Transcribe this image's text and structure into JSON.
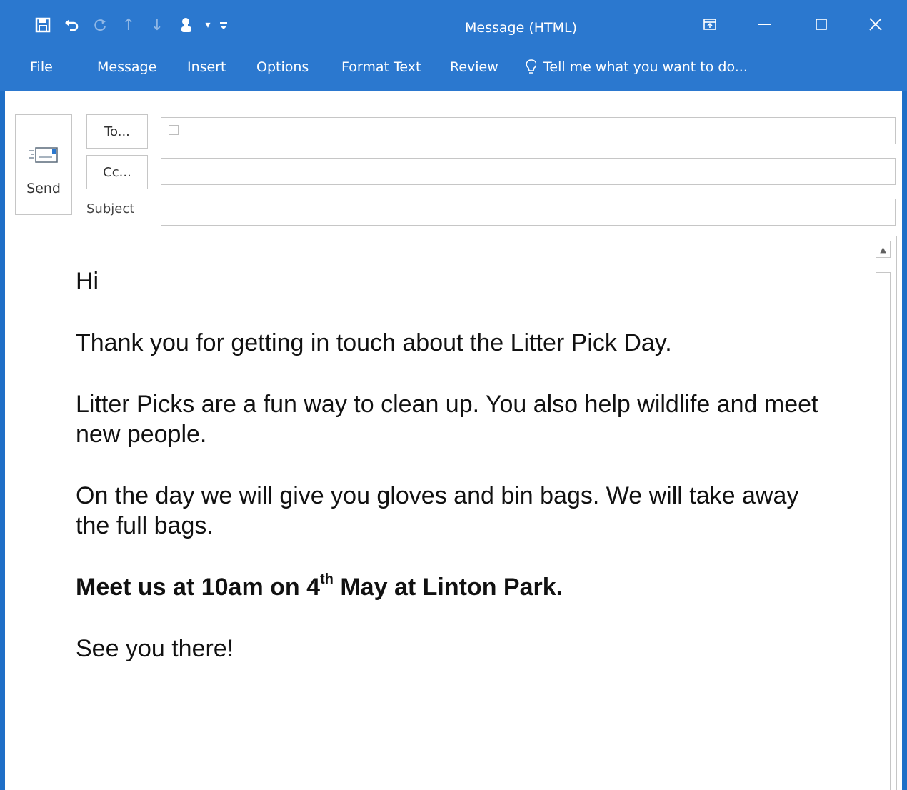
{
  "window": {
    "title": "Message (HTML)",
    "accent_color": "#2b78cf"
  },
  "quick_access": [
    {
      "name": "save-icon",
      "glyph": "🖫"
    },
    {
      "name": "undo-icon",
      "glyph": "↶"
    },
    {
      "name": "redo-icon",
      "glyph": "↷"
    },
    {
      "name": "up-arrow-icon",
      "glyph": "↑"
    },
    {
      "name": "down-arrow-icon",
      "glyph": "↓"
    },
    {
      "name": "touch-mode-icon",
      "glyph": "☝"
    },
    {
      "name": "dropdown-icon",
      "glyph": "▾"
    },
    {
      "name": "customize-icon",
      "glyph": "≡"
    }
  ],
  "window_controls": {
    "ribbon_display": "⊡",
    "minimize": "—",
    "maximize": "☐",
    "close": "✕"
  },
  "tabs": [
    "File",
    "Message",
    "Insert",
    "Options",
    "Format Text",
    "Review"
  ],
  "tellme": "Tell me what you want to do...",
  "header": {
    "send_label": "Send",
    "to_label": "To...",
    "cc_label": "Cc...",
    "subject_label": "Subject",
    "to_value": "",
    "cc_value": "",
    "subject_value": ""
  },
  "body": {
    "greeting": "Hi",
    "para1": "Thank you for getting in touch about the Litter Pick Day.",
    "para2": "Litter Picks are a fun way to clean up. You also help wildlife and meet new people.",
    "para3": "On the day we will give you gloves and bin bags. We will take away the full bags.",
    "para4_before": "Meet us at 10am on 4",
    "para4_sup": "th",
    "para4_after": " May at Linton Park.",
    "para5": "See you there!"
  }
}
